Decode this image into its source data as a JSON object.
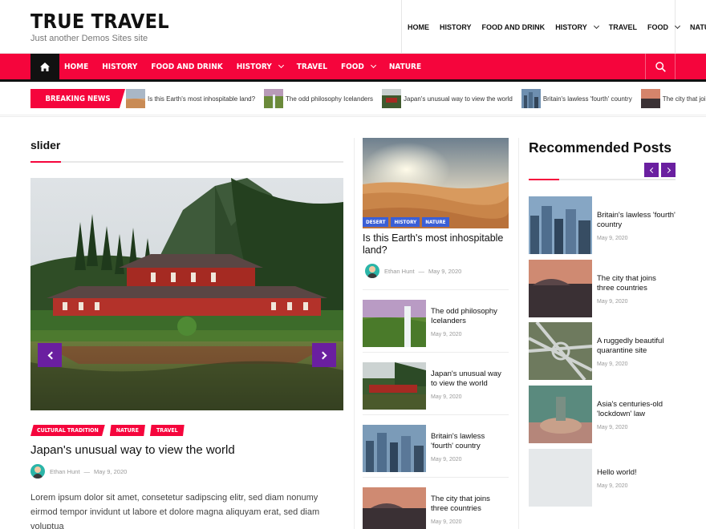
{
  "header": {
    "title": "TRUE TRAVEL",
    "tagline": "Just another Demos Sites site",
    "top_nav": [
      {
        "label": "HOME",
        "has_dropdown": false
      },
      {
        "label": "HISTORY",
        "has_dropdown": false
      },
      {
        "label": "FOOD AND DRINK",
        "has_dropdown": false
      },
      {
        "label": "HISTORY",
        "has_dropdown": true
      },
      {
        "label": "TRAVEL",
        "has_dropdown": false
      },
      {
        "label": "FOOD",
        "has_dropdown": true
      },
      {
        "label": "NATURE",
        "has_dropdown": false
      }
    ]
  },
  "main_nav": {
    "home_icon": "home-icon",
    "search_icon": "search-icon",
    "links": [
      {
        "label": "HOME",
        "has_dropdown": false
      },
      {
        "label": "HISTORY",
        "has_dropdown": false
      },
      {
        "label": "FOOD AND DRINK",
        "has_dropdown": false
      },
      {
        "label": "HISTORY",
        "has_dropdown": true
      },
      {
        "label": "TRAVEL",
        "has_dropdown": false
      },
      {
        "label": "FOOD",
        "has_dropdown": true
      },
      {
        "label": "NATURE",
        "has_dropdown": false
      }
    ]
  },
  "ticker": {
    "label": "BREAKING NEWS",
    "items": [
      "Is this Earth's most inhospitable land?",
      "The odd philosophy Icelanders",
      "Japan's unusual way to view the world",
      "Britain's lawless 'fourth' country",
      "The city that joins three countries"
    ]
  },
  "slider": {
    "heading": "slider",
    "tags": [
      "CULTURAL TRADITION",
      "NATURE",
      "TRAVEL"
    ],
    "title": "Japan's unusual way to view the world",
    "author": "Ethan Hunt",
    "separator": "—",
    "date": "May 9, 2020",
    "excerpt": "Lorem ipsum dolor sit amet, consetetur sadipscing elitr, sed diam nonumy eirmod tempor invidunt ut labore et dolore magna aliquyam erat, sed diam voluptua"
  },
  "feature": {
    "tags": [
      "DESERT",
      "HISTORY",
      "NATURE"
    ],
    "title": "Is this Earth's most inhospitable land?",
    "author": "Ethan Hunt",
    "separator": "—",
    "date": "May 9, 2020"
  },
  "middle_list": [
    {
      "title": "The odd philosophy Icelanders",
      "date": "May 9, 2020"
    },
    {
      "title": "Japan's unusual way to view the world",
      "date": "May 9, 2020"
    },
    {
      "title": "Britain's lawless 'fourth' country",
      "date": "May 9, 2020"
    },
    {
      "title": "The city that joins three countries",
      "date": "May 9, 2020"
    }
  ],
  "recommended": {
    "heading": "Recommended Posts",
    "posts": [
      {
        "title": "Britain's lawless 'fourth' country",
        "date": "May 9, 2020"
      },
      {
        "title": "The city that joins three countries",
        "date": "May 9, 2020"
      },
      {
        "title": "A ruggedly beautiful quarantine site",
        "date": "May 9, 2020"
      },
      {
        "title": "Asia's centuries-old 'lockdown' law",
        "date": "May 9, 2020"
      },
      {
        "title": "Hello world!",
        "date": "May 9, 2020"
      }
    ]
  },
  "colors": {
    "accent": "#f5053c",
    "purple": "#6a1fa0",
    "blue_tag": "#3b5fd6",
    "dark": "#111111"
  }
}
